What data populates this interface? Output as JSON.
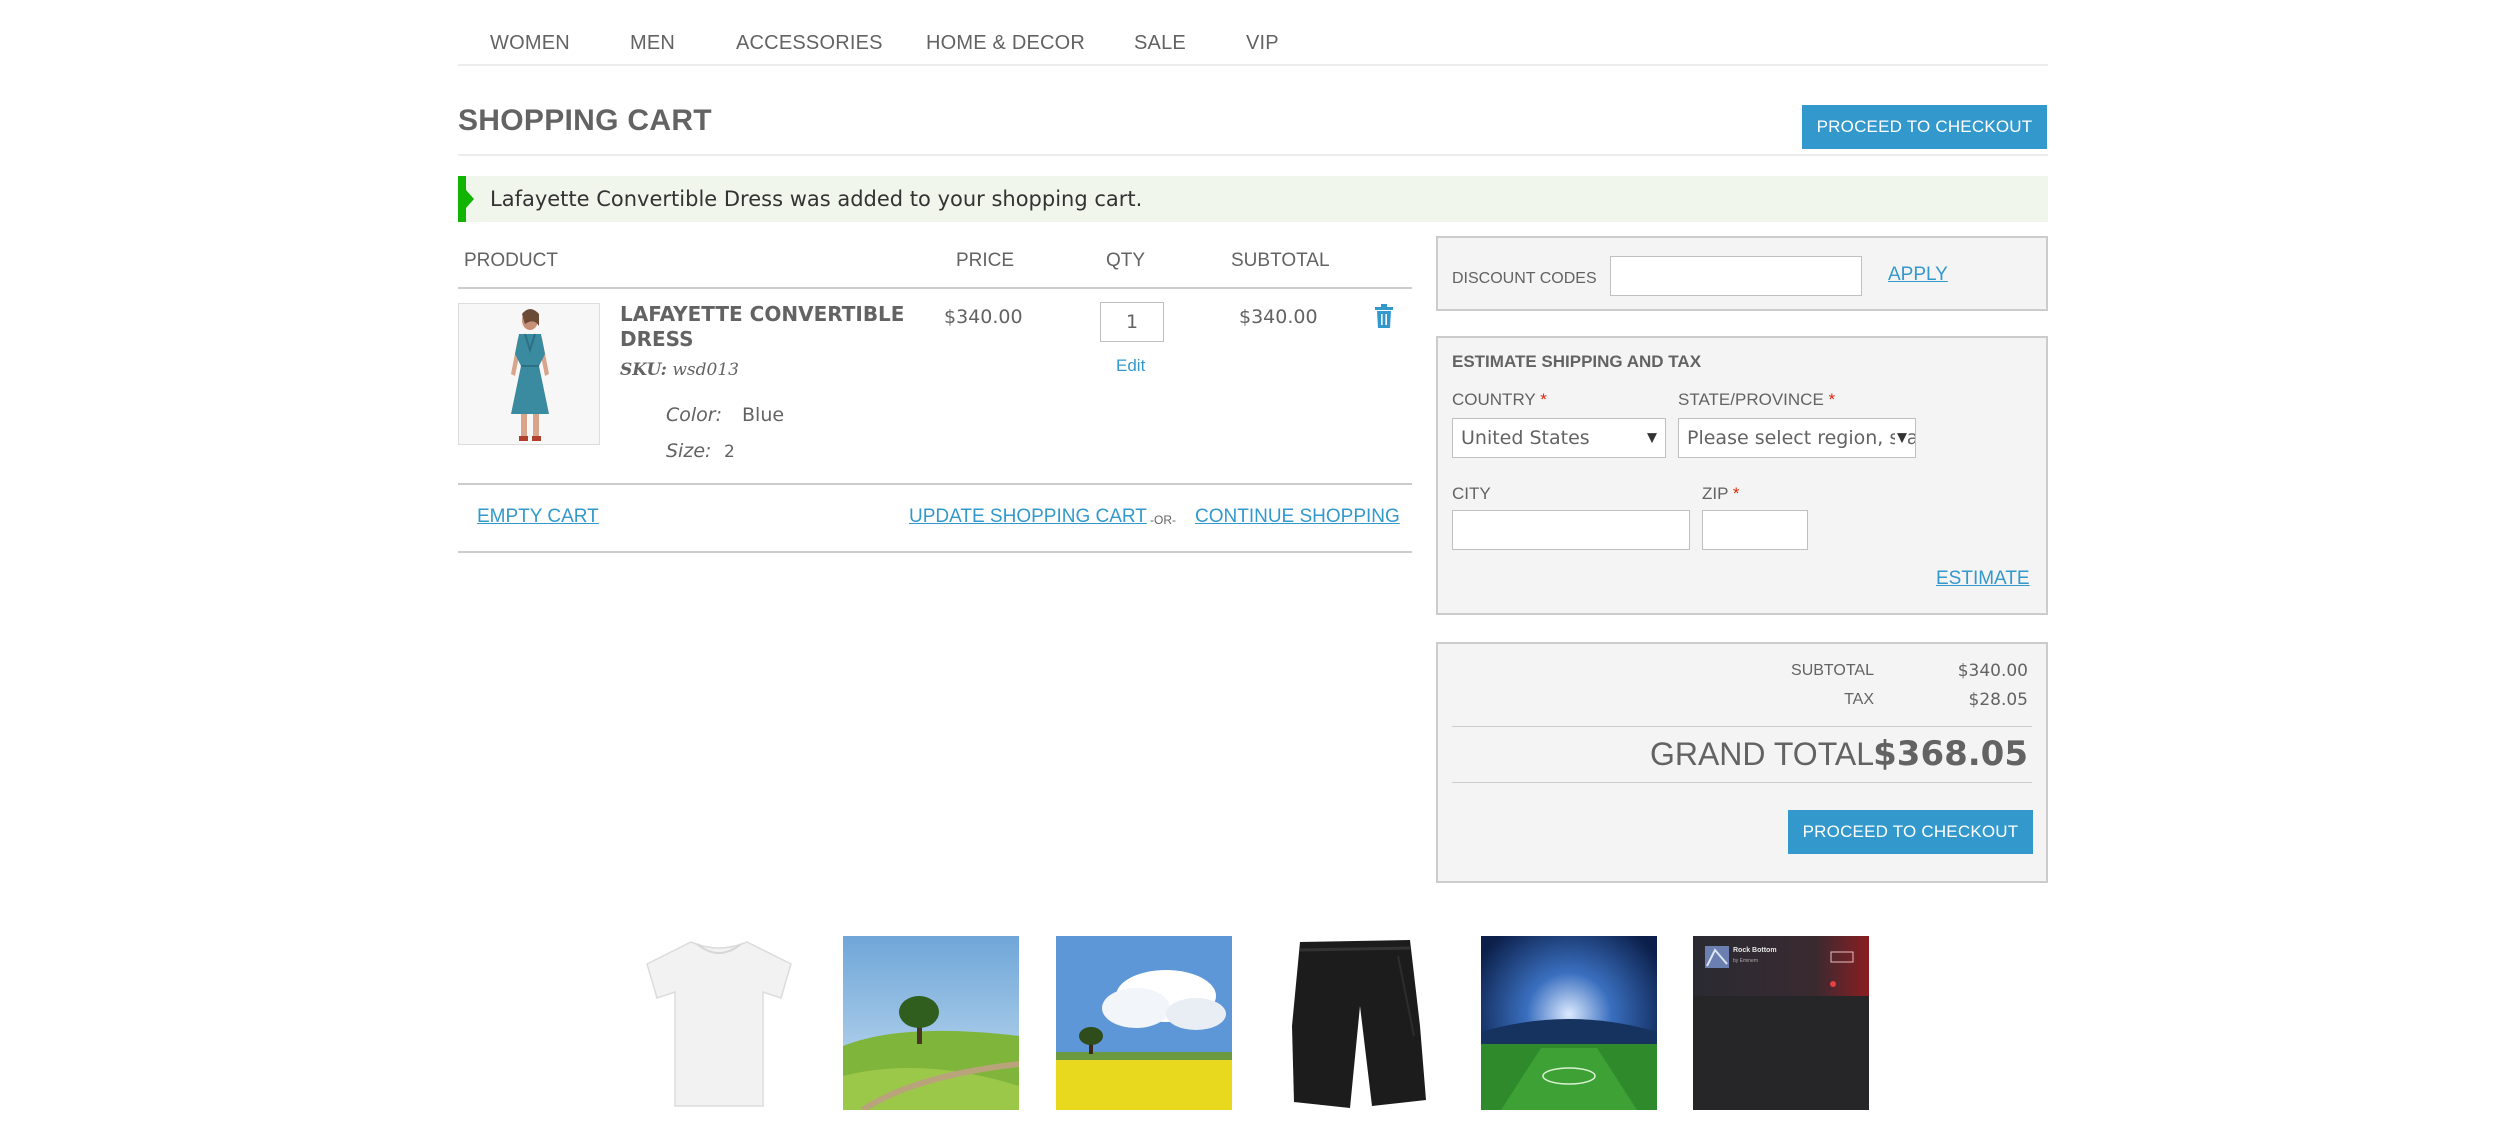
{
  "nav": {
    "items": [
      {
        "label": "WOMEN"
      },
      {
        "label": "MEN"
      },
      {
        "label": "ACCESSORIES"
      },
      {
        "label": "HOME & DECOR"
      },
      {
        "label": "SALE"
      },
      {
        "label": "VIP"
      }
    ]
  },
  "page": {
    "title": "SHOPPING CART",
    "checkout_label": "PROCEED TO CHECKOUT"
  },
  "message": {
    "text": "Lafayette Convertible Dress was added to your shopping cart."
  },
  "cart": {
    "headers": {
      "product": "PRODUCT",
      "price": "PRICE",
      "qty": "QTY",
      "subtotal": "SUBTOTAL"
    },
    "item": {
      "name": "LAFAYETTE CONVERTIBLE DRESS",
      "sku_label": "SKU:",
      "sku": "wsd013",
      "color_label": "Color:",
      "color": "Blue",
      "size_label": "Size:",
      "size": "2",
      "price": "$340.00",
      "qty": "1",
      "edit_label": "Edit",
      "subtotal": "$340.00",
      "remove_icon": "trash-icon"
    },
    "actions": {
      "empty_label": "EMPTY CART",
      "update_label": "UPDATE SHOPPING CART",
      "or_label": "-OR-",
      "continue_label": "CONTINUE SHOPPING"
    }
  },
  "discount": {
    "label": "DISCOUNT CODES",
    "value": "",
    "apply_label": "APPLY"
  },
  "shipping": {
    "title": "ESTIMATE SHIPPING AND TAX",
    "country_label": "COUNTRY",
    "country_value": "United States",
    "state_label": "STATE/PROVINCE",
    "state_value": "Please select region, state or province",
    "city_label": "CITY",
    "city_value": "",
    "zip_label": "ZIP",
    "zip_value": "",
    "required_mark": "*",
    "estimate_label": "ESTIMATE"
  },
  "totals": {
    "subtotal_label": "SUBTOTAL",
    "subtotal_value": "$340.00",
    "tax_label": "TAX",
    "tax_value": "$28.05",
    "grand_label": "GRAND TOTAL",
    "grand_value": "$368.05",
    "checkout_label": "PROCEED TO CHECKOUT"
  },
  "thumbnails": [
    {
      "name": "white-tshirt"
    },
    {
      "name": "tree-on-hill"
    },
    {
      "name": "tree-in-field"
    },
    {
      "name": "black-shorts"
    },
    {
      "name": "stadium"
    },
    {
      "name": "music-album",
      "title": "Rock Bottom",
      "subtitle": "by Eminem"
    }
  ],
  "colors": {
    "accent": "#3399cc",
    "success": "#11b400",
    "required": "#df280a"
  }
}
